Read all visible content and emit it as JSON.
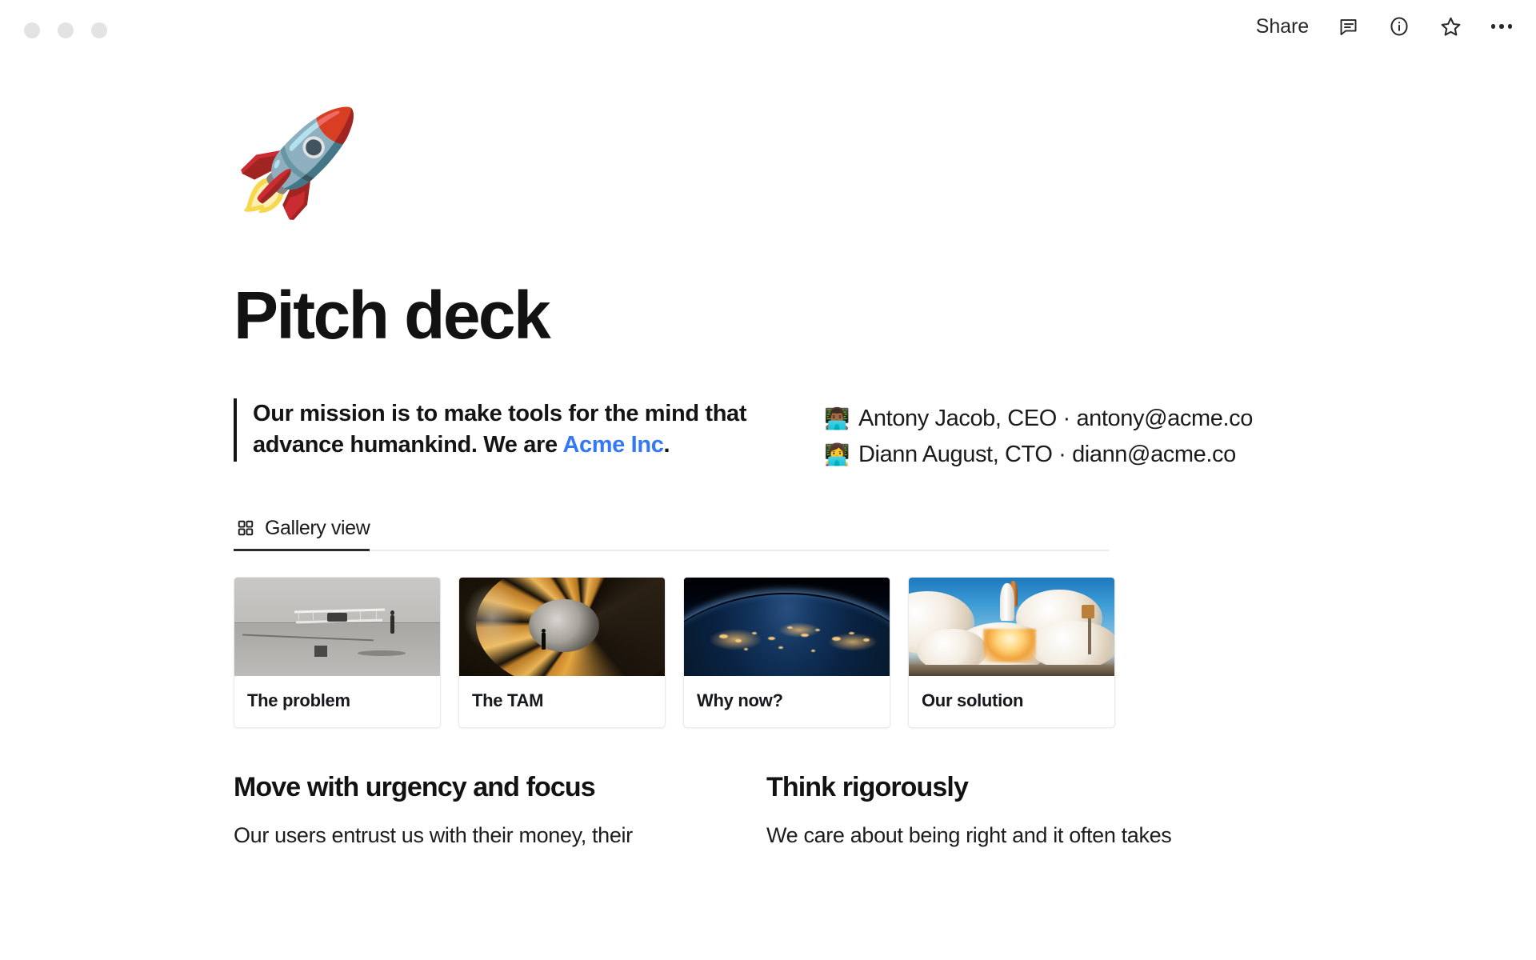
{
  "window": {
    "dots": [
      "minimize-dot",
      "maximize-dot",
      "close-dot"
    ]
  },
  "topbar": {
    "share_label": "Share",
    "icons": [
      {
        "name": "comment-icon",
        "glyph": "comment"
      },
      {
        "name": "info-icon",
        "glyph": "info"
      },
      {
        "name": "star-icon",
        "glyph": "star"
      },
      {
        "name": "more-options-icon",
        "glyph": "ellipsis"
      }
    ]
  },
  "page": {
    "emoji": "🚀",
    "title": "Pitch deck"
  },
  "mission": {
    "quote_part1": "Our mission is to make tools for the mind that advance humankind. We are ",
    "quote_link": "Acme Inc",
    "quote_part2": "."
  },
  "people": [
    {
      "avatar": "👨🏾‍💻",
      "text": "Antony Jacob, CEO · antony@acme.co"
    },
    {
      "avatar": "👩‍💻",
      "text": "Diann August, CTO · diann@acme.co"
    }
  ],
  "view": {
    "tab_label": "Gallery view",
    "tab_icon": "gallery-grid-icon",
    "active": true
  },
  "gallery": {
    "cards": [
      {
        "title": "The problem",
        "image": "vintage-biplane-on-beach"
      },
      {
        "title": "The TAM",
        "image": "golden-turbine-spiral"
      },
      {
        "title": "Why now?",
        "image": "earth-from-space-at-night"
      },
      {
        "title": "Our solution",
        "image": "space-shuttle-launch"
      }
    ]
  },
  "columns": [
    {
      "heading": "Move with urgency and focus",
      "body": "Our users entrust us with their money, their"
    },
    {
      "heading": "Think rigorously",
      "body": "We care about being right and it often takes"
    }
  ],
  "colors": {
    "link": "#3478f6",
    "text": "#141414",
    "tab_active": "#2b2b2b",
    "rule": "#ececec",
    "card_border": "#eaeaea"
  }
}
